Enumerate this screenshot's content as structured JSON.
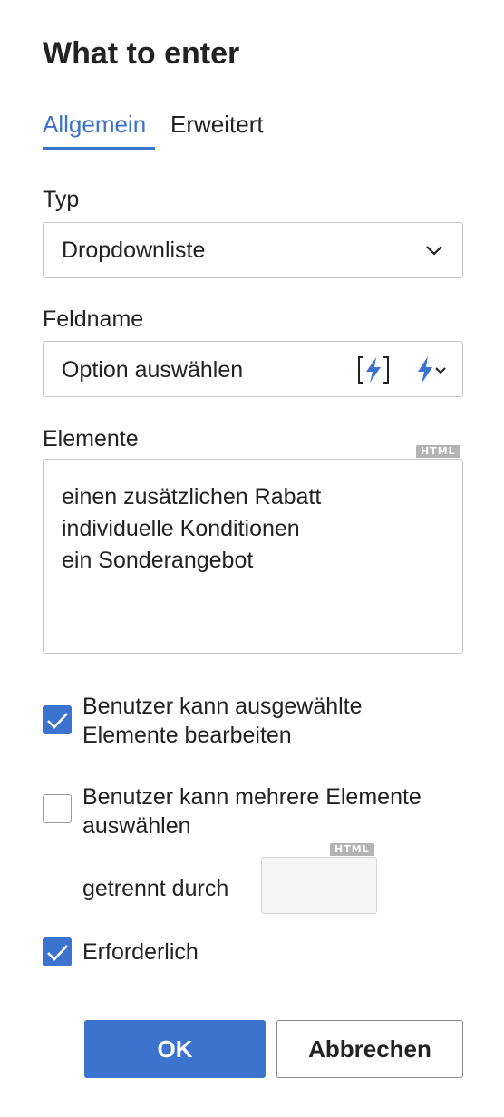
{
  "dialog": {
    "title": "What to enter"
  },
  "tabs": [
    {
      "label": "Allgemein",
      "active": true
    },
    {
      "label": "Erweitert",
      "active": false
    }
  ],
  "type_field": {
    "label": "Typ",
    "value": "Dropdownliste",
    "icon": "chevron-down-icon"
  },
  "fieldname": {
    "label": "Feldname",
    "value": "Option auswählen",
    "icons": [
      "insert-field-icon",
      "lightning-dropdown-icon"
    ]
  },
  "elements": {
    "label": "Elemente",
    "badge": "HTML",
    "lines": [
      "einen zusätzlichen Rabatt",
      "individuelle Konditionen",
      "ein Sonderangebot"
    ]
  },
  "options": {
    "edit_selected": {
      "line1": "Benutzer kann ausgewählte",
      "line2": "Elemente bearbeiten",
      "checked": true
    },
    "multi_select": {
      "line1": "Benutzer kann mehrere Elemente",
      "line2": "auswählen",
      "checked": false
    },
    "separator": {
      "label": "getrennt durch",
      "badge": "HTML",
      "value": ""
    },
    "required": {
      "label": "Erforderlich",
      "checked": true
    }
  },
  "buttons": {
    "ok": "OK",
    "cancel": "Abbrechen"
  },
  "colors": {
    "accent": "#3b73cf",
    "border": "#c8c8c8",
    "badge": "#b3b3b3"
  }
}
